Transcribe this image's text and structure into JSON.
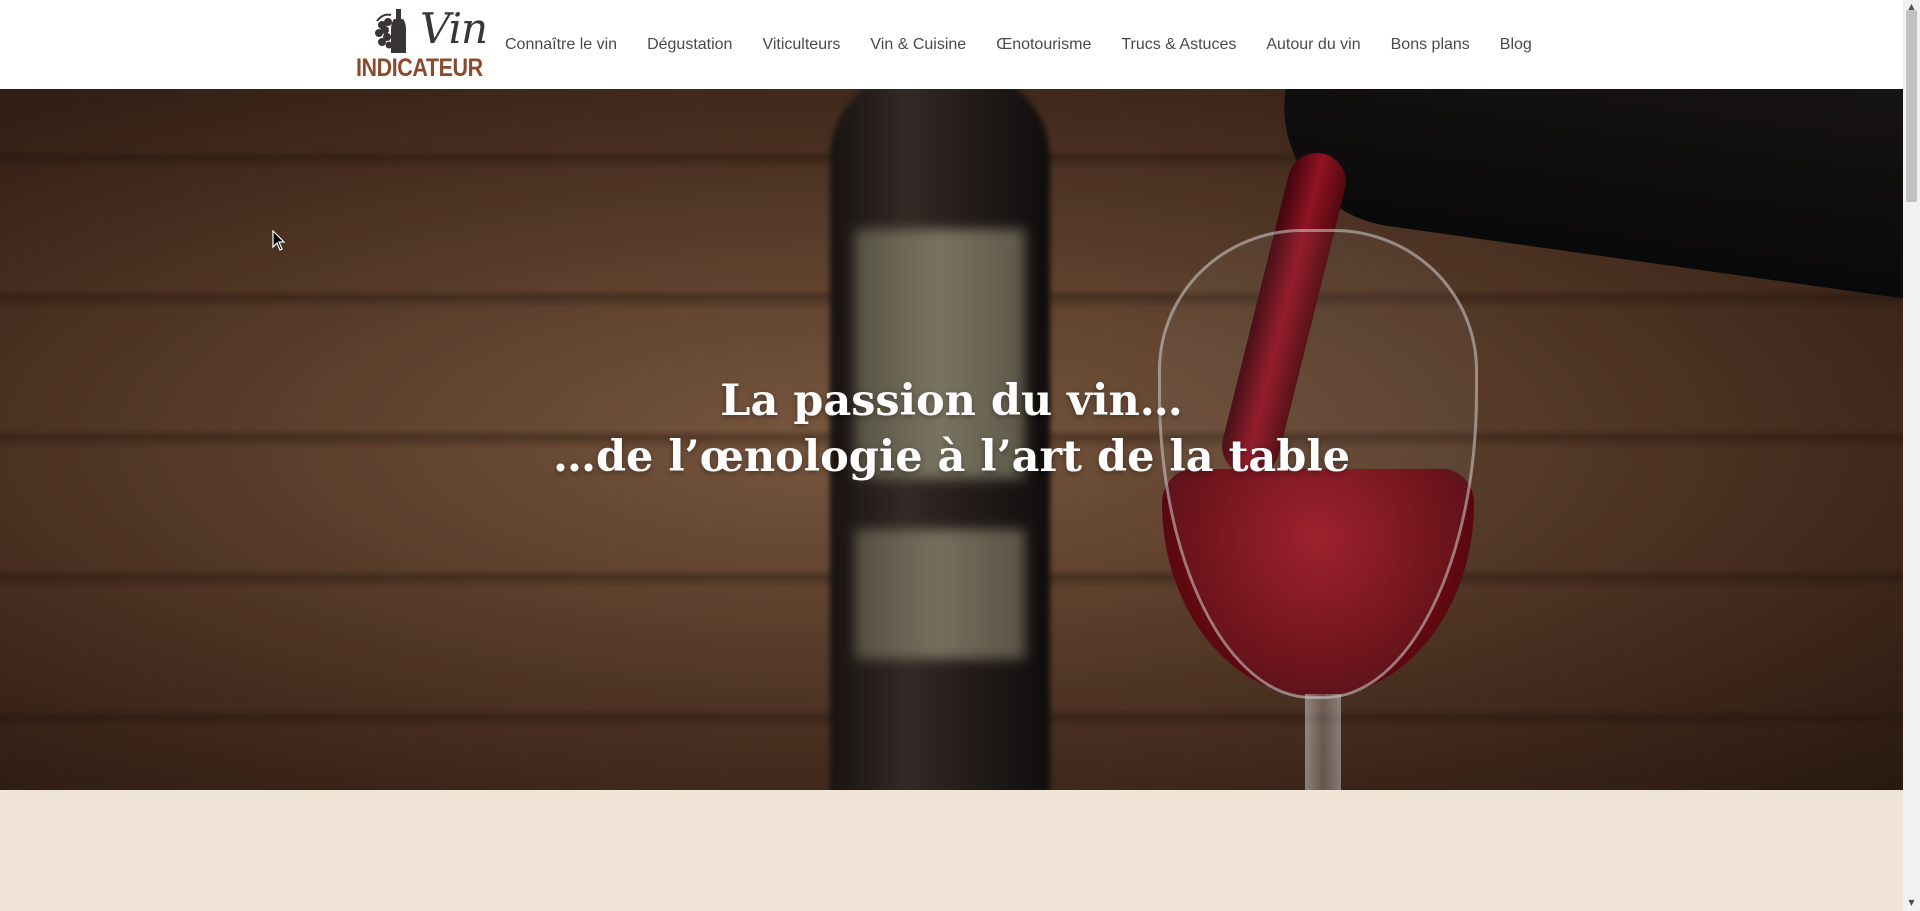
{
  "header": {
    "logo": {
      "script_text": "Vin",
      "word_text": "INDICATEUR",
      "colors": {
        "script": "#3a3535",
        "word": "#8b4a2b"
      }
    },
    "nav": [
      {
        "label": "Connaître le vin"
      },
      {
        "label": "Dégustation"
      },
      {
        "label": "Viticulteurs"
      },
      {
        "label": "Vin & Cuisine"
      },
      {
        "label": "Œnotourisme"
      },
      {
        "label": "Trucs & Astuces"
      },
      {
        "label": "Autour du vin"
      },
      {
        "label": "Bons plans"
      },
      {
        "label": "Blog"
      }
    ]
  },
  "hero": {
    "line1": "La passion du vin…",
    "line2": "…de l’œnologie à l’art de la table",
    "image": "red-wine-pouring-into-glass"
  },
  "section": {
    "background": "#f1e5d8"
  },
  "icons": {
    "cursor": "mouse-pointer-icon",
    "scroll_up": "chevron-up-icon",
    "scroll_down": "chevron-down-icon"
  }
}
